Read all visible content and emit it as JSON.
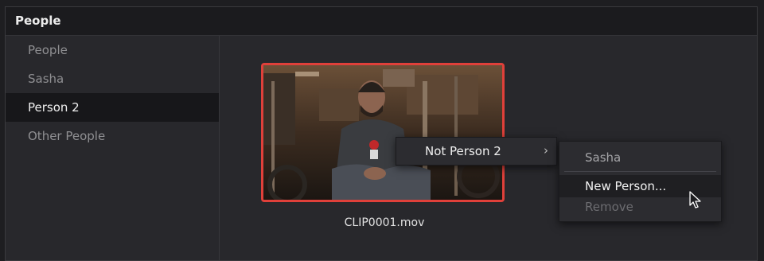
{
  "window": {
    "title": "People"
  },
  "sidebar": {
    "items": [
      {
        "label": "People"
      },
      {
        "label": "Sasha"
      },
      {
        "label": "Person 2",
        "selected": true
      },
      {
        "label": "Other People"
      }
    ]
  },
  "clip": {
    "name": "CLIP0001.mov"
  },
  "context_menu": {
    "item": "Not Person 2",
    "submenu_arrow": "chevron-right-icon"
  },
  "submenu": {
    "items": [
      {
        "label": "Sasha"
      },
      {
        "label": "New Person...",
        "highlighted": true
      },
      {
        "label": "Remove",
        "disabled": true
      }
    ]
  },
  "colors": {
    "selection_border": "#e0403a",
    "highlight_row": "#1f1f22",
    "selected_sidebar": "#17171a"
  }
}
